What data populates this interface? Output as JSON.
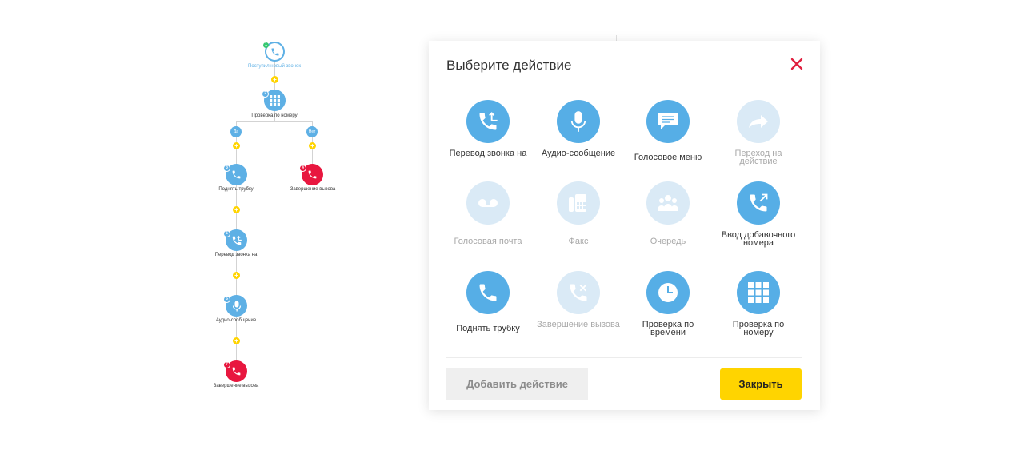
{
  "flow": {
    "start_label": "Поступил новый звонок",
    "start_badge": "1",
    "check_number_label": "Проверка по номеру",
    "check_number_badge": "2",
    "branch_yes": "Да",
    "branch_no": "Нет",
    "plus_sign": "+",
    "pickup_label": "Поднять трубку",
    "pickup_badge": "3",
    "end_right_label": "Завершение вызова",
    "end_right_badge": "4",
    "transfer_label": "Перевод звонка на",
    "transfer_badge": "5",
    "audio_label": "Аудио-сообщение",
    "audio_badge": "6",
    "end_bottom_label": "Завершение вызова",
    "end_bottom_badge": "7"
  },
  "modal": {
    "title": "Выберите действие",
    "actions": [
      {
        "label": "Перевод звонка на",
        "enabled": true,
        "icon": "call-transfer-icon"
      },
      {
        "label": "Аудио-сообщение",
        "enabled": true,
        "icon": "microphone-icon"
      },
      {
        "label": "Голосовое меню",
        "enabled": true,
        "icon": "chat-bubble-icon"
      },
      {
        "label": "Переход на действие",
        "enabled": false,
        "icon": "forward-arrow-icon"
      },
      {
        "label": "Голосовая почта",
        "enabled": false,
        "icon": "voicemail-icon"
      },
      {
        "label": "Факс",
        "enabled": false,
        "icon": "fax-icon"
      },
      {
        "label": "Очередь",
        "enabled": false,
        "icon": "people-queue-icon"
      },
      {
        "label": "Ввод добавочного номера",
        "enabled": true,
        "icon": "extension-call-icon"
      },
      {
        "label": "Поднять трубку",
        "enabled": true,
        "icon": "phone-icon"
      },
      {
        "label": "Завершение вызова",
        "enabled": false,
        "icon": "hangup-icon"
      },
      {
        "label": "Проверка по времени",
        "enabled": true,
        "icon": "clock-icon"
      },
      {
        "label": "Проверка по номеру",
        "enabled": true,
        "icon": "keypad-grid-icon"
      }
    ],
    "add_action_label": "Добавить действие",
    "close_label": "Закрыть"
  },
  "colors": {
    "accent_blue": "#56aee6",
    "disabled_blue": "#daeaf6",
    "end_red": "#e8173f",
    "close_x_red": "#e0203f",
    "close_yellow": "#ffd400"
  }
}
